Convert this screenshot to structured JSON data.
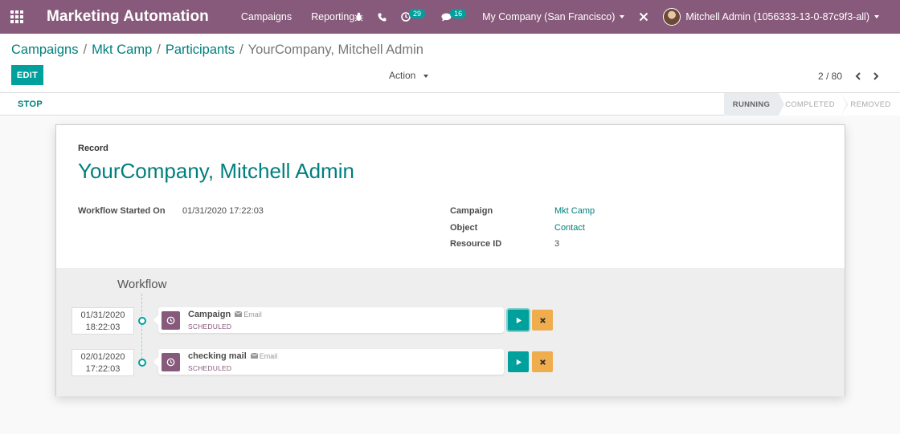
{
  "navbar": {
    "brand": "Marketing Automation",
    "menu": [
      "Campaigns",
      "Reporting"
    ],
    "activity_count": "29",
    "message_count": "16",
    "company": "My Company (San Francisco)",
    "user": "Mitchell Admin (1056333-13-0-87c9f3-all)"
  },
  "control_panel": {
    "breadcrumb": [
      "Campaigns",
      "Mkt Camp",
      "Participants"
    ],
    "breadcrumb_active": "YourCompany, Mitchell Admin",
    "edit_label": "EDIT",
    "action_label": "Action",
    "pager": "2 / 80"
  },
  "statusbar": {
    "stop_label": "STOP",
    "stages": [
      "RUNNING",
      "COMPLETED",
      "REMOVED"
    ],
    "active_stage": "RUNNING"
  },
  "record": {
    "label": "Record",
    "title": "YourCompany, Mitchell Admin",
    "workflow_started_label": "Workflow Started On",
    "workflow_started_value": "01/31/2020 17:22:03",
    "campaign_label": "Campaign",
    "campaign_value": "Mkt Camp",
    "object_label": "Object",
    "object_value": "Contact",
    "resource_label": "Resource ID",
    "resource_value": "3"
  },
  "workflow": {
    "title": "Workflow",
    "items": [
      {
        "date": "01/31/2020",
        "time": "18:22:03",
        "name": "Campaign",
        "type": "Email",
        "state": "SCHEDULED"
      },
      {
        "date": "02/01/2020",
        "time": "17:22:03",
        "name": "checking mail",
        "type": "Email",
        "state": "SCHEDULED"
      }
    ]
  },
  "colors": {
    "brand": "#875a7b",
    "accent": "#00a09d",
    "link": "#00807d",
    "warning": "#f0ad4e"
  }
}
